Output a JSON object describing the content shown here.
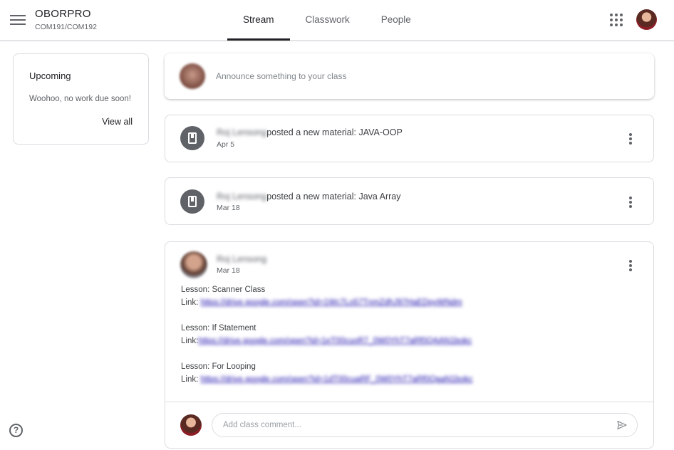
{
  "header": {
    "menu_icon": "hamburger-menu-icon",
    "class_name": "OBORPRO",
    "class_section": "COM191/COM192",
    "tabs": [
      {
        "label": "Stream",
        "active": true
      },
      {
        "label": "Classwork",
        "active": false
      },
      {
        "label": "People",
        "active": false
      }
    ],
    "apps_icon": "apps-grid-icon"
  },
  "upcoming": {
    "title": "Upcoming",
    "message": "Woohoo, no work due soon!",
    "view_all": "View all"
  },
  "announce": {
    "placeholder": "Announce something to your class"
  },
  "stream": {
    "materials": [
      {
        "author": "Roj Lensong",
        "action": "posted a new material: JAVA-OOP",
        "date": "Apr 5"
      },
      {
        "author": "Roj Lensong",
        "action": "posted a new material: Java Array",
        "date": "Mar 18"
      }
    ],
    "post": {
      "author": "Roj Lensong",
      "date": "Mar 18",
      "lessons": [
        {
          "lesson": "Lesson: Scanner Class",
          "link_label": "Link:",
          "url": "https://drive.google.com/open?id=1Wc7Lo57TnmZdhJ97HaEDpyWNdm"
        },
        {
          "lesson": "Lesson: If Statement",
          "link_label": "Link:",
          "url": "https://drive.google.com/open?id=1eT00cuoR7_0W0YhT7aRf0QAAN1bokc"
        },
        {
          "lesson": "Lesson: For Looping",
          "link_label": "Link:",
          "url": "https://drive.google.com/open?id=1dT00cuaRF_0W0YhT7aRf0QaaN1bokc"
        }
      ],
      "comment_placeholder": "Add class comment..."
    }
  },
  "colors": {
    "text_primary": "#202124",
    "text_secondary": "#5f6368",
    "border": "#dadce0",
    "link": "#1a0dab"
  }
}
